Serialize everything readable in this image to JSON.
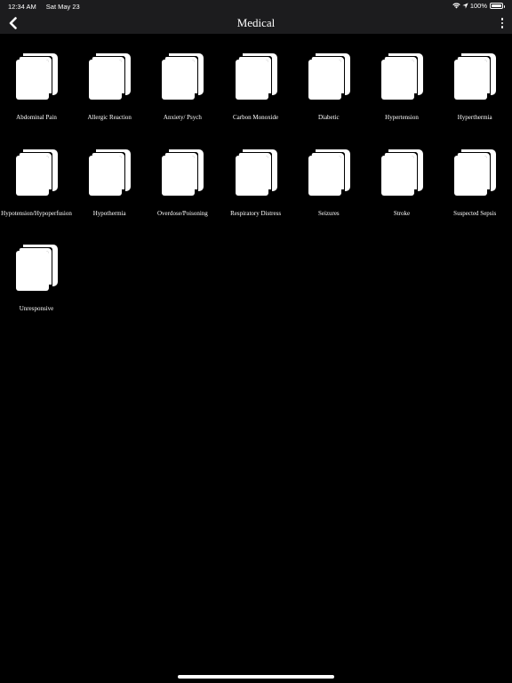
{
  "status_bar": {
    "time": "12:34 AM",
    "date": "Sat May 23",
    "battery": "100%",
    "battery_level": 1.0
  },
  "nav": {
    "title": "Medical"
  },
  "items": [
    {
      "label": "Abdominal Pain",
      "icon": "book-icon"
    },
    {
      "label": "Allergic Reaction",
      "icon": "book-icon"
    },
    {
      "label": "Anxiety/ Psych",
      "icon": "book-icon"
    },
    {
      "label": "Carbon Monoxide",
      "icon": "book-icon"
    },
    {
      "label": "Diabetic",
      "icon": "book-icon"
    },
    {
      "label": "Hypertension",
      "icon": "book-icon"
    },
    {
      "label": "Hyperthermia",
      "icon": "book-icon"
    },
    {
      "label": "Hypotension/Hypoperfusion",
      "icon": "book-icon"
    },
    {
      "label": "Hypothermia",
      "icon": "book-icon"
    },
    {
      "label": "Overdose/Poisoning",
      "icon": "book-icon"
    },
    {
      "label": "Respiratory Distress",
      "icon": "book-icon"
    },
    {
      "label": "Seizures",
      "icon": "book-icon"
    },
    {
      "label": "Stroke",
      "icon": "book-icon"
    },
    {
      "label": "Suspected Sepsis",
      "icon": "book-icon"
    },
    {
      "label": "Unresponsive",
      "icon": "book-icon"
    }
  ],
  "colors": {
    "background": "#000000",
    "bar": "#1c1c1e",
    "foreground": "#ffffff"
  }
}
